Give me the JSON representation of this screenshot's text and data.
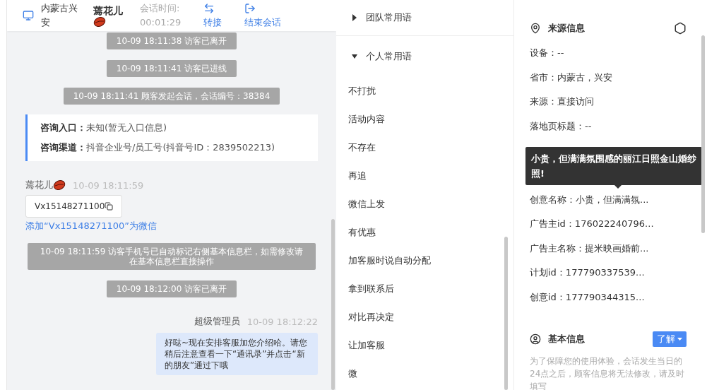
{
  "chat_header": {
    "location": "内蒙古兴安",
    "visitor_name": "蔫花儿",
    "session_time_label": "会话时间:",
    "session_time": "00:01:29",
    "actions": [
      {
        "kind": "transfer",
        "label": "转接"
      },
      {
        "kind": "end",
        "label": "结束会话"
      }
    ]
  },
  "messages": [
    {
      "kind": "system",
      "text": "10-09 18:11:38 访客已离开"
    },
    {
      "kind": "system",
      "text": "10-09 18:11:41 访客已进线"
    },
    {
      "kind": "system",
      "text": "10-09 18:11:41 顾客发起会话，会话编号：38384"
    },
    {
      "kind": "info",
      "rows": [
        {
          "label": "咨询入口：",
          "value": "未知(暂无入口信息)"
        },
        {
          "label": "咨询渠道：",
          "value": "抖音企业号/员工号(抖音号ID：2839502213)"
        }
      ]
    },
    {
      "kind": "visitor",
      "name": "蔫花儿",
      "time": "10-09 18:11:59",
      "text": "Vx15148271100",
      "link": "添加“Vx15148271100”为微信"
    },
    {
      "kind": "system",
      "text": "10-09 18:11:59 访客手机号已自动标记右侧基本信息栏，如需修改请在基本信息栏直接操作"
    },
    {
      "kind": "system",
      "text": "10-09 18:12:00 访客已离开"
    },
    {
      "kind": "agent",
      "name": "超级管理员",
      "time": "10-09 18:12:22",
      "text": "好哒~现在安排客服加您介绍哈。请您稍后注意查看一下“通讯录”并点击“新的朋友”通过下哦"
    }
  ],
  "phrases": {
    "groups": [
      {
        "label": "团队常用语",
        "expanded": false
      },
      {
        "label": "个人常用语",
        "expanded": true
      }
    ],
    "items": [
      "不打扰",
      "活动内容",
      "不存在",
      "再追",
      "微信上发",
      "有优惠",
      "加客服时说自动分配",
      "拿到联系后",
      "对比再决定",
      "让加客服",
      "微"
    ]
  },
  "source_info": {
    "title": "来源信息",
    "rows": [
      "设备：--",
      "省市：内蒙古，兴安",
      "来源：直接访问",
      "落地页标题：--",
      "创意名称：小贵，但满满氛...",
      "广告主id：176022240796...",
      "广告主名称：提米映画婚前...",
      "计划id：177790337539...",
      "创意id：177790344315..."
    ],
    "tooltip": "小贵，但满满氛围感的丽江日照金山婚纱照!"
  },
  "basic_info": {
    "title": "基本信息",
    "button": "了解",
    "notice": "为了保障您的使用体验，会话发生当日的24点之后，顾客信息将无法修改，请及时填写"
  }
}
